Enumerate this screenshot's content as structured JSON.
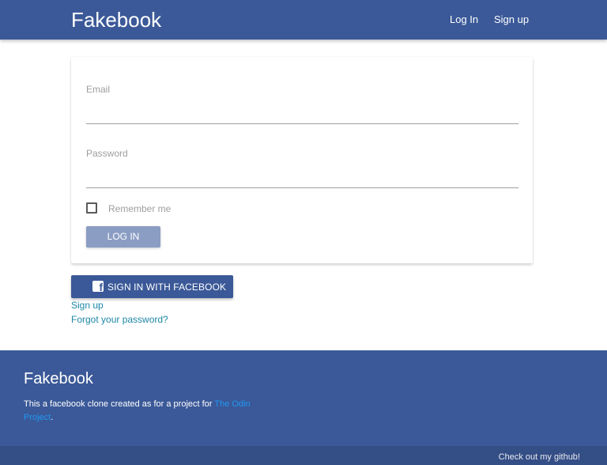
{
  "navbar": {
    "brand": "Fakebook",
    "links": [
      {
        "label": "Log In"
      },
      {
        "label": "Sign up"
      }
    ],
    "color": "#3b5998"
  },
  "login_form": {
    "email_label": "Email",
    "email_value": "",
    "password_label": "Password",
    "password_value": "",
    "remember_label": "Remember me",
    "remember_checked": false,
    "submit_label": "LOG IN",
    "submit_color": "#8b9dc3"
  },
  "facebook_button": {
    "icon": "facebook-f-icon",
    "label": "SIGN IN WITH FACEBOOK"
  },
  "links": {
    "signup": "Sign up",
    "forgot": "Forgot your password?"
  },
  "footer": {
    "title": "Fakebook",
    "text_before": "This a facebook clone created as for a project for ",
    "link_text": "The Odin Project",
    "text_after": ".",
    "github_label": "Check out my github!"
  }
}
